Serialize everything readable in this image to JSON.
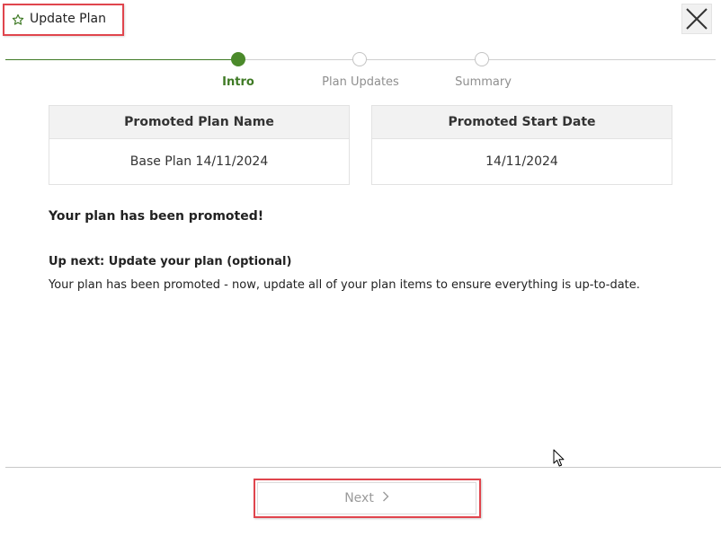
{
  "header": {
    "title": "Update Plan",
    "star_icon": "star-outline-icon",
    "close_icon": "close-icon"
  },
  "stepper": {
    "steps": [
      {
        "label": "Intro",
        "state": "active"
      },
      {
        "label": "Plan Updates",
        "state": "pending"
      },
      {
        "label": "Summary",
        "state": "pending"
      }
    ]
  },
  "info": {
    "promoted_plan_name_header": "Promoted Plan Name",
    "promoted_plan_name_value": "Base Plan 14/11/2024",
    "promoted_start_date_header": "Promoted Start Date",
    "promoted_start_date_value": "14/11/2024"
  },
  "messages": {
    "promoted": "Your plan has been promoted!",
    "up_next_heading": "Up next: Update your plan (optional)",
    "up_next_description": "Your plan has been promoted - now, update all of your plan items to ensure everything is up-to-date."
  },
  "footer": {
    "next_label": "Next",
    "next_icon": "chevron-right-icon",
    "next_enabled": false
  },
  "colors": {
    "accent_green": "#3f7a25",
    "highlight_red": "#e0454d",
    "muted_text": "#8f8f8f"
  }
}
